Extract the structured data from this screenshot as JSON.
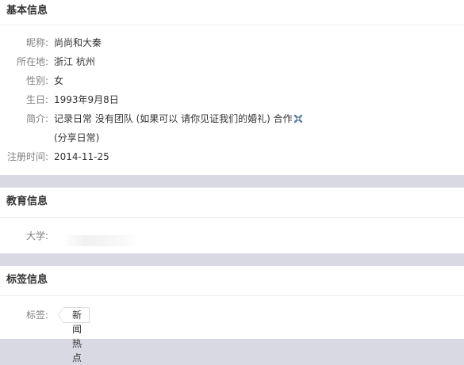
{
  "basic_info": {
    "title": "基本信息",
    "nickname_label": "昵称:",
    "nickname_value": "尚尚和大秦",
    "location_label": "所在地:",
    "location_value": "浙江 杭州",
    "gender_label": "性别:",
    "gender_value": "女",
    "birthday_label": "生日:",
    "birthday_value": "1993年9月8日",
    "intro_label": "简介:",
    "intro_line1": "记录日常 没有团队 (如果可以 请你见证我们的婚礼) 合作",
    "intro_emoji": "cross-emoji-icon",
    "intro_line2": "(分享日常)",
    "register_label": "注册时间:",
    "register_value": "2014-11-25"
  },
  "education_info": {
    "title": "教育信息",
    "university_label": "大学:"
  },
  "tag_info": {
    "title": "标签信息",
    "tags_label": "标签:",
    "tags": [
      "新闻热点"
    ]
  },
  "colors": {
    "page_background": "#d9d9e3",
    "card_background": "#ffffff",
    "label_text": "#808080",
    "value_text": "#333333"
  }
}
